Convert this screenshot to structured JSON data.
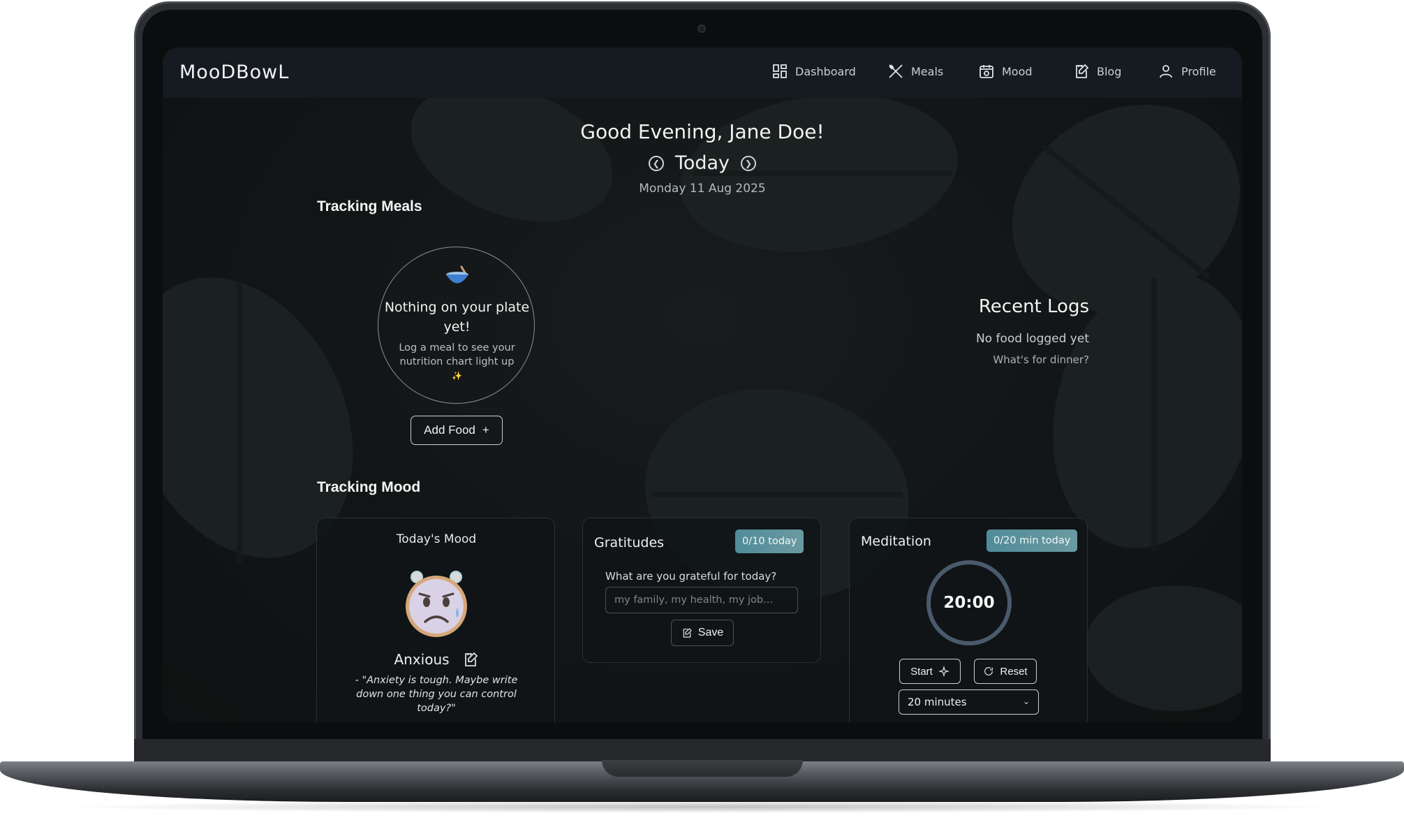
{
  "navbar": {
    "brand": "MooDBowL",
    "items": [
      {
        "label": "Dashboard",
        "icon": "dashboard-icon"
      },
      {
        "label": "Meals",
        "icon": "utensils-icon"
      },
      {
        "label": "Mood",
        "icon": "calendar-clock-icon"
      },
      {
        "label": "Blog",
        "icon": "edit-note-icon"
      },
      {
        "label": "Profile",
        "icon": "user-icon"
      }
    ]
  },
  "header": {
    "greeting": "Good Evening, Jane Doe!",
    "day": "Today",
    "date": "Monday 11 Aug 2025",
    "prev_icon": "chevron-left-circle-icon",
    "next_icon": "chevron-right-circle-icon"
  },
  "meals": {
    "section_title": "Tracking Meals",
    "empty_title": "Nothing on your plate yet!",
    "empty_sub": "Log a meal to see your nutrition chart light up",
    "sparkle": "✨",
    "add_button": "Add Food",
    "add_icon": "plus-icon"
  },
  "recent_logs": {
    "title": "Recent Logs",
    "empty": "No food logged yet",
    "sub": "What's for dinner?"
  },
  "mood": {
    "section_title": "Tracking Mood",
    "card_label": "Today's Mood",
    "mood_name": "Anxious",
    "quote": "- \"Anxiety is tough. Maybe write down one thing you can control today?\"",
    "face_icon": "anxious-face-icon",
    "edit_icon": "edit-icon"
  },
  "gratitudes": {
    "title": "Gratitudes",
    "badge": "0/10 today",
    "question": "What are you grateful for today?",
    "placeholder": "my family, my health, my job...",
    "save_label": "Save"
  },
  "meditation": {
    "title": "Meditation",
    "badge": "0/20 min today",
    "timer": "20:00",
    "start_label": "Start",
    "reset_label": "Reset",
    "duration": "20 minutes"
  },
  "colors": {
    "accent": "#4f8c9a",
    "timer_ring": "#4a5a6c",
    "background": "#121516"
  }
}
